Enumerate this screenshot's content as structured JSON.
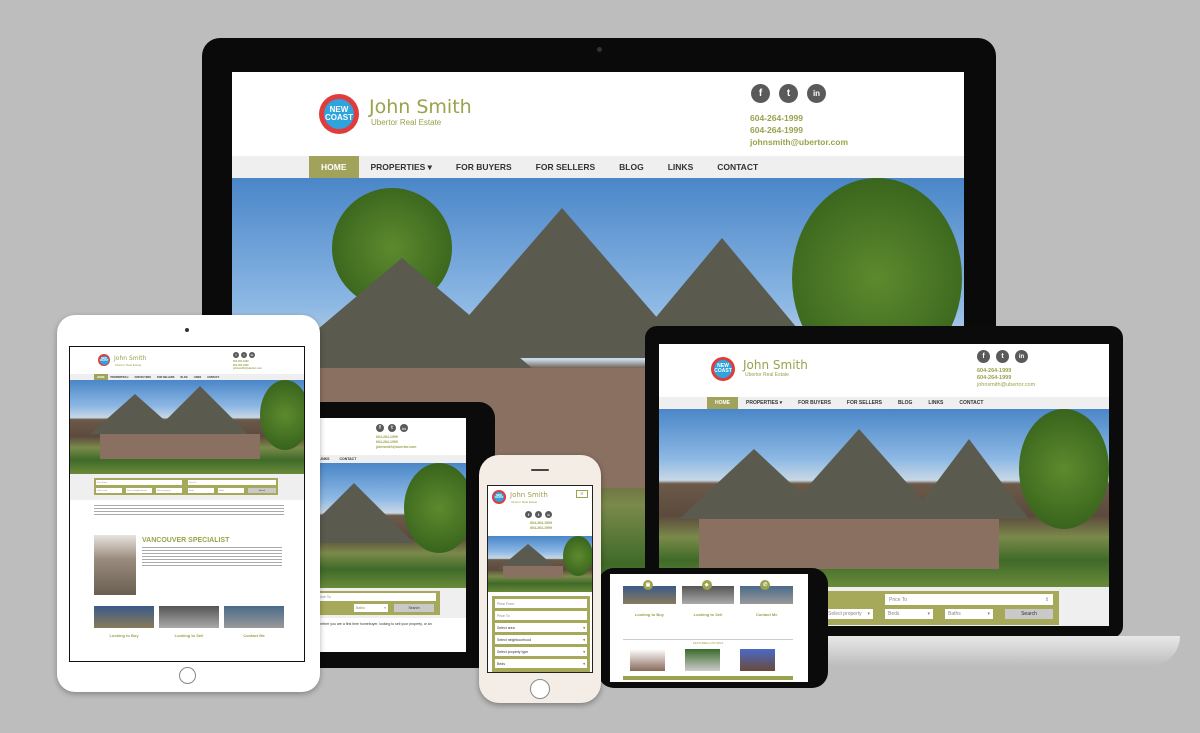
{
  "site": {
    "logo_text": "NEW COAST",
    "agent_name": "John Smith",
    "company": "Ubertor Real Estate",
    "phone_1": "604-264-1999",
    "phone_2": "604-264-1999",
    "email": "johnsmith@ubertor.com",
    "social": [
      {
        "icon": "facebook-icon",
        "glyph": "f"
      },
      {
        "icon": "twitter-icon",
        "glyph": "t"
      },
      {
        "icon": "linkedin-icon",
        "glyph": "in"
      }
    ],
    "nav": [
      {
        "label": "HOME",
        "active": true
      },
      {
        "label": "PROPERTIES ▾"
      },
      {
        "label": "FOR BUYERS"
      },
      {
        "label": "FOR SELLERS"
      },
      {
        "label": "BLOG"
      },
      {
        "label": "LINKS"
      },
      {
        "label": "CONTACT"
      }
    ]
  },
  "search": {
    "price_from_placeholder": "Price From",
    "price_to_placeholder": "Price To",
    "area": "Select area",
    "neighbourhood": "Select neighbourhood",
    "property_type": "Select property type",
    "property_short": "Select property",
    "beds": "Beds",
    "baths": "Baths",
    "search_label": "Search"
  },
  "content": {
    "specialist_heading": "VANCOUVER SPECIALIST",
    "intro_snippet": "Whether you are a first time homebuyer, looking to sell your property, or an",
    "cards": [
      {
        "title": "Looking to Buy",
        "icon": "cart-icon",
        "glyph": "🛒"
      },
      {
        "title": "Looking to Sell",
        "icon": "tag-icon",
        "glyph": "🏷"
      },
      {
        "title": "Contact Me",
        "icon": "phone-icon",
        "glyph": "✆"
      }
    ],
    "featured_heading": "FEATURED LISTINGS"
  },
  "colors": {
    "accent": "#9aa24c",
    "nav_active": "#a1a35a",
    "background": "#bdbdbd"
  }
}
